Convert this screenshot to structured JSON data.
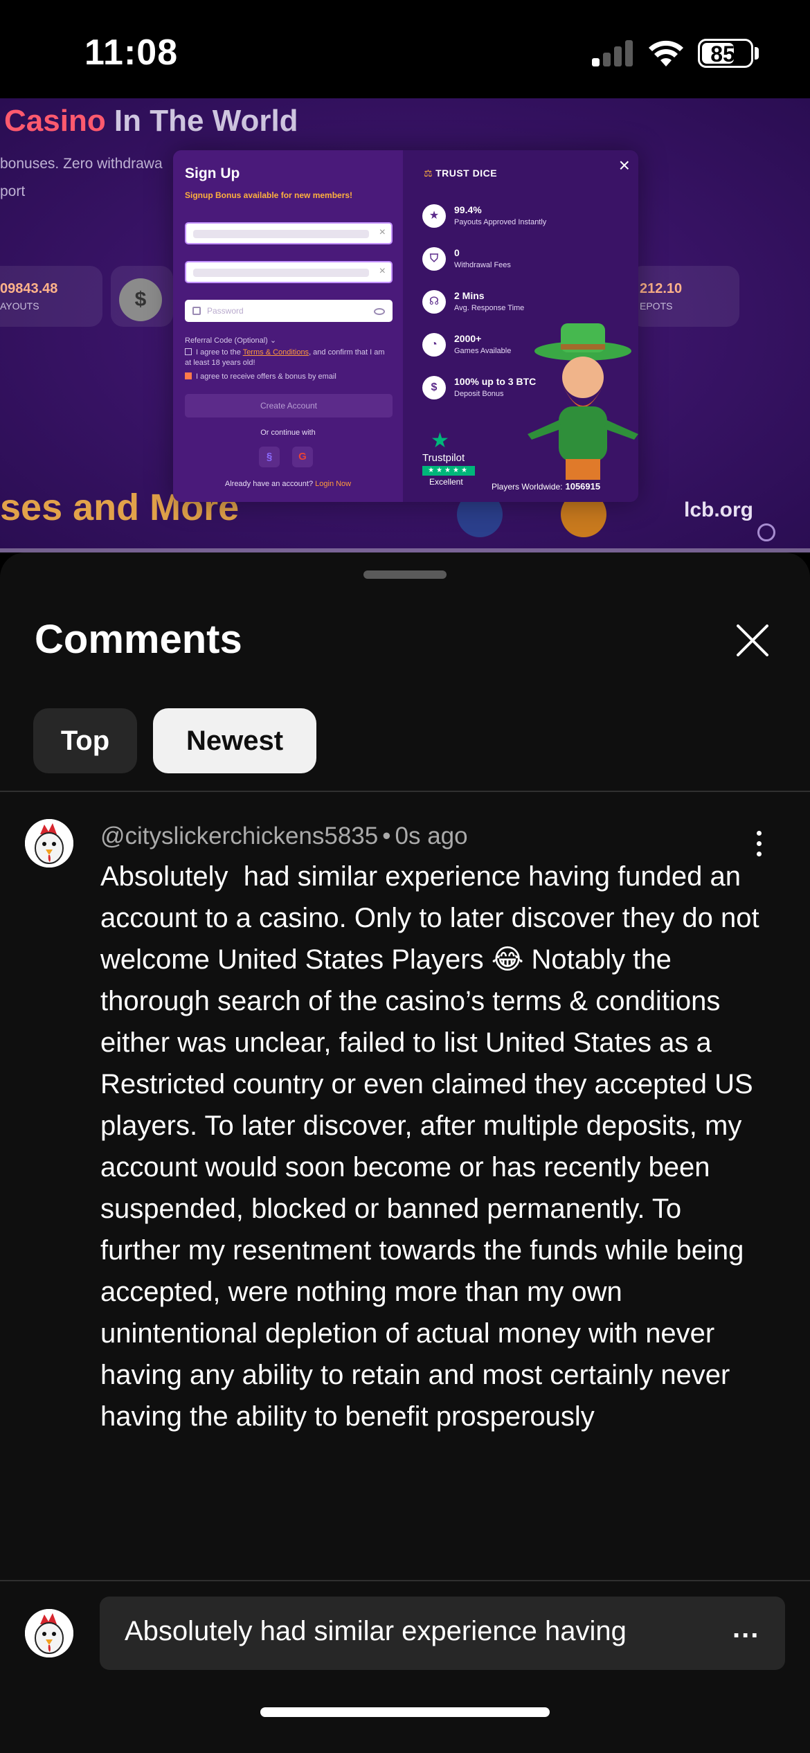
{
  "status_bar": {
    "time": "11:08",
    "battery_level": "85",
    "signal_bars_active": 1
  },
  "video": {
    "background": {
      "headline_accent": "Casino",
      "headline_rest": " In The World",
      "subtext": "bonuses. Zero withdrawa\nport",
      "stat_left_value": "09843.48",
      "stat_left_label": "AYOUTS",
      "stat_right_value": "212.10",
      "stat_right_label": "EPOTS",
      "coin_glyph": "$",
      "bottom_text": "ses and More",
      "domain": "lcb.org"
    },
    "modal": {
      "title": "Sign Up",
      "subtitle": "Signup Bonus available for new members!",
      "password_placeholder": "Password",
      "referral": "Referral Code (Optional)",
      "terms_prefix": "I agree to the ",
      "terms_link": "Terms & Conditions",
      "terms_suffix": ", and confirm that I am at least 18 years old!",
      "offers": "I agree to receive offers & bonus by email",
      "create_button": "Create Account",
      "or_continue": "Or continue with",
      "login_prompt": "Already have an account?",
      "login_link": "Login Now",
      "brand": "TRUST DICE",
      "features": [
        {
          "value": "99.4%",
          "label": "Payouts Approved Instantly"
        },
        {
          "value": "0",
          "label": "Withdrawal Fees"
        },
        {
          "value": "2 Mins",
          "label": "Avg. Response Time"
        },
        {
          "value": "2000+",
          "label": "Games Available"
        },
        {
          "value": "100% up to 3 BTC",
          "label": "Deposit Bonus"
        }
      ],
      "trustpilot": "Trustpilot",
      "trustpilot_rating": "Excellent",
      "players_label": "Players Worldwide:",
      "players_value": "1056915"
    },
    "progress_fraction": 0.0
  },
  "comments": {
    "title": "Comments",
    "filters": [
      {
        "label": "Top",
        "selected": false
      },
      {
        "label": "Newest",
        "selected": true
      }
    ],
    "items": [
      {
        "author": "@cityslickerchickens5835",
        "time": "0s ago",
        "text": "Absolutely  had similar experience having funded an account to a casino. Only to later discover they do not welcome United States Players 😂 Notably the thorough search of the casino’s terms & conditions either was unclear, failed to list United States as a Restricted country or even claimed they accepted US players. To later discover, after multiple deposits, my account would soon become or has recently been suspended, blocked or banned permanently. To further my resentment towards the funds while being accepted, were nothing more than my own unintentional depletion of actual money with never having any ability to retain and most certainly never having the ability to benefit prosperously"
      }
    ],
    "reply_preview": "Absolutely  had similar experience having",
    "reply_more": "..."
  },
  "colors": {
    "sheet_bg": "#0f0f0f",
    "chip_selected_bg": "#f1f1f1",
    "chip_bg": "#272727",
    "video_purple": "#3a1468",
    "accent_orange": "#ff9a3d"
  }
}
